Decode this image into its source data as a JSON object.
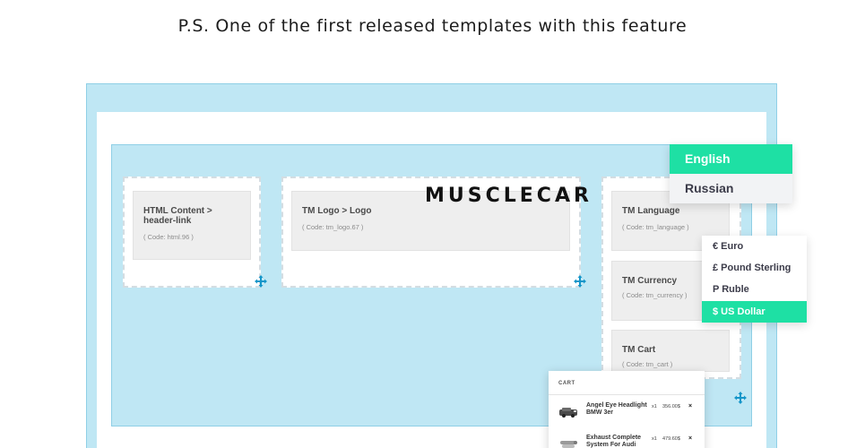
{
  "headline": "P.S. One of the first released templates with this feature",
  "modules": {
    "html_content": {
      "title": "HTML Content > header-link",
      "code": "( Code: html.96 )"
    },
    "tm_logo": {
      "title": "TM Logo > Logo",
      "code": "( Code: tm_logo.67 )"
    },
    "tm_language": {
      "title": "TM Language",
      "code": "( Code: tm_language )"
    },
    "tm_currency": {
      "title": "TM Currency",
      "code": "( Code: tm_currency )"
    },
    "tm_cart": {
      "title": "TM Cart",
      "code": "( Code: tm_cart )"
    }
  },
  "logo": "MUSCLECAR",
  "language_dropdown": {
    "items": [
      {
        "label": "English",
        "active": true
      },
      {
        "label": "Russian",
        "active": false
      }
    ]
  },
  "currency_dropdown": {
    "items": [
      {
        "label": "€ Euro",
        "active": false
      },
      {
        "label": "£ Pound Sterling",
        "active": false
      },
      {
        "label": "P Ruble",
        "active": false
      },
      {
        "label": "$ US Dollar",
        "active": true
      }
    ]
  },
  "cart": {
    "title": "CART",
    "items": [
      {
        "name": "Angel Eye Headlight BMW 3er",
        "qty": "x1",
        "price": "356.00$",
        "remove": "×"
      },
      {
        "name": "Exhaust Complete System For Audi",
        "qty": "x1",
        "price": "479.60$",
        "remove": "×"
      }
    ]
  },
  "colors": {
    "accent": "#1ee0a4",
    "zone_blue": "#bfe7f4",
    "handle_blue": "#1596c9"
  },
  "icons": {
    "move": "move-cross-icon",
    "remove": "close-icon"
  }
}
